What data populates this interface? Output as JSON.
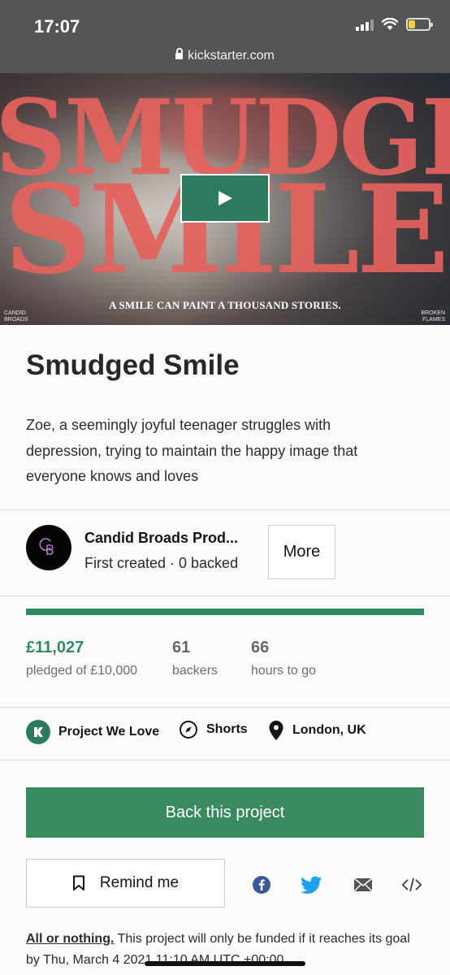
{
  "status_bar": {
    "time": "17:07",
    "battery_level": 0.35,
    "signal_bars": 3
  },
  "browser": {
    "url": "kickstarter.com"
  },
  "hero": {
    "title_line1": "SMUDGED",
    "title_line2": "SMILE",
    "tagline": "A SMILE CAN PAINT A THOUSAND STORIES.",
    "logo_left": "CANDID BROADS",
    "logo_right": "BROKEN FLAMES",
    "accent_color": "#e5625e"
  },
  "project": {
    "title": "Smudged Smile",
    "blurb": "Zoe, a seemingly joyful teenager struggles with depression, trying to maintain the happy image that everyone knows and loves"
  },
  "creator": {
    "name": "Candid Broads Prod...",
    "meta": "First created · 0 backed",
    "more_label": "More",
    "avatar_initials": "CB"
  },
  "funding": {
    "progress": 1.0,
    "pledged": "£11,027",
    "pledged_label": "pledged of £10,000",
    "backers": "61",
    "backers_label": "backers",
    "hours": "66",
    "hours_label": "hours to go",
    "accent_color": "#2f8a63"
  },
  "tags": {
    "badge": "Project We Love",
    "category": "Shorts",
    "location": "London, UK"
  },
  "actions": {
    "back_label": "Back this project",
    "remind_label": "Remind me",
    "share": [
      "facebook-icon",
      "twitter-icon",
      "email-icon",
      "embed-icon"
    ]
  },
  "fineprint": {
    "lead": "All or nothing.",
    "text": " This project will only be funded if it reaches its goal by Thu, March 4 2021 11:10 AM UTC +00:00."
  }
}
